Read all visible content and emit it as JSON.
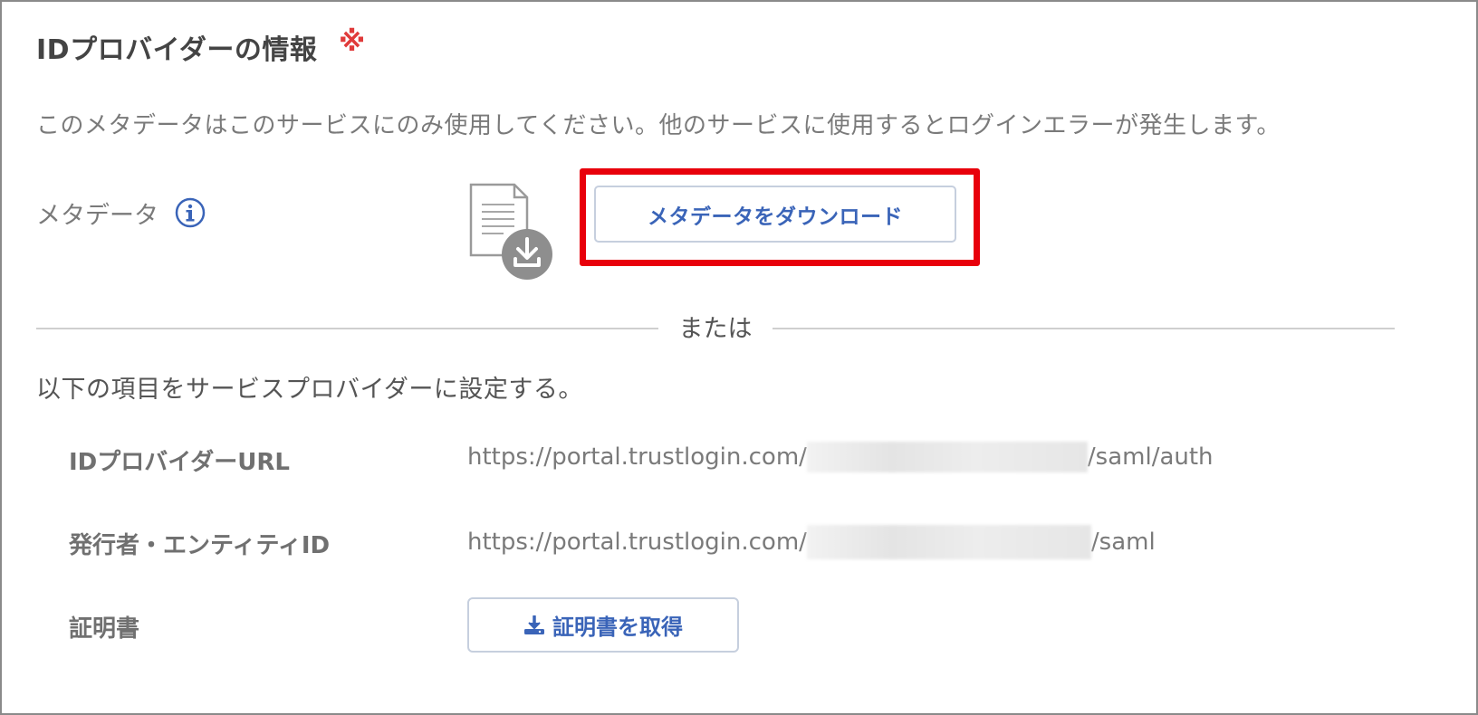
{
  "section": {
    "title": "IDプロバイダーの情報",
    "required_mark": "※",
    "notice": "このメタデータはこのサービスにのみ使用してください。他のサービスに使用するとログインエラーが発生します。"
  },
  "metadata": {
    "label": "メタデータ",
    "info_icon": "info-circle-icon",
    "file_icon": "document-download-icon",
    "download_button": "メタデータをダウンロード"
  },
  "divider": {
    "or_text": "または"
  },
  "instruction": "以下の項目をサービスプロバイダーに設定する。",
  "fields": {
    "idp_url": {
      "label": "IDプロバイダーURL",
      "prefix": "https://portal.trustlogin.com/",
      "suffix": "/saml/auth"
    },
    "entity_id": {
      "label": "発行者・エンティティID",
      "prefix": "https://portal.trustlogin.com/",
      "suffix": "/saml"
    },
    "certificate": {
      "label": "証明書",
      "button": "証明書を取得",
      "button_icon": "download-icon"
    }
  },
  "colors": {
    "accent": "#3a64b8",
    "highlight": "#e8000b",
    "required": "#e03a3a"
  }
}
